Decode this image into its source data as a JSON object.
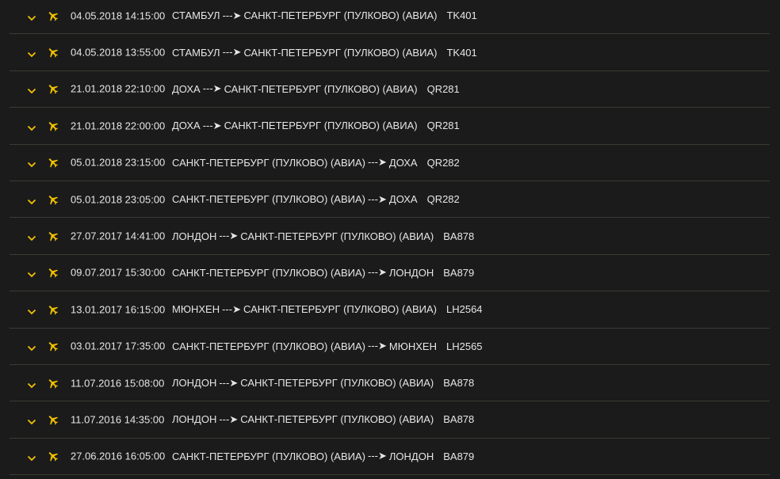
{
  "colors": {
    "background": "#1b1b1b",
    "accent": "#f2c200",
    "text": "#e6e6e6",
    "divider": "#3a3a34"
  },
  "icons": {
    "expand": "chevron-down-icon",
    "flight": "airplane-icon"
  },
  "flights": [
    {
      "datetime": "04.05.2018 14:15:00",
      "from": "СТАМБУЛ",
      "arrow": "---➤",
      "to": "САНКТ-ПЕТЕРБУРГ (ПУЛКОВО) (АВИА)",
      "flight": "TK401"
    },
    {
      "datetime": "04.05.2018 13:55:00",
      "from": "СТАМБУЛ",
      "arrow": "---➤",
      "to": "САНКТ-ПЕТЕРБУРГ (ПУЛКОВО) (АВИА)",
      "flight": "TK401"
    },
    {
      "datetime": "21.01.2018 22:10:00",
      "from": "ДОХА",
      "arrow": "---➤",
      "to": "САНКТ-ПЕТЕРБУРГ (ПУЛКОВО) (АВИА)",
      "flight": "QR281"
    },
    {
      "datetime": "21.01.2018 22:00:00",
      "from": "ДОХА",
      "arrow": "---➤",
      "to": "САНКТ-ПЕТЕРБУРГ (ПУЛКОВО) (АВИА)",
      "flight": "QR281"
    },
    {
      "datetime": "05.01.2018 23:15:00",
      "from": "САНКТ-ПЕТЕРБУРГ (ПУЛКОВО) (АВИА)",
      "arrow": "---➤",
      "to": "ДОХА",
      "flight": "QR282"
    },
    {
      "datetime": "05.01.2018 23:05:00",
      "from": "САНКТ-ПЕТЕРБУРГ (ПУЛКОВО) (АВИА)",
      "arrow": "---➤",
      "to": "ДОХА",
      "flight": "QR282"
    },
    {
      "datetime": "27.07.2017 14:41:00",
      "from": "ЛОНДОН",
      "arrow": "---➤",
      "to": "САНКТ-ПЕТЕРБУРГ (ПУЛКОВО) (АВИА)",
      "flight": "BA878"
    },
    {
      "datetime": "09.07.2017 15:30:00",
      "from": "САНКТ-ПЕТЕРБУРГ (ПУЛКОВО) (АВИА)",
      "arrow": "---➤",
      "to": "ЛОНДОН",
      "flight": "BA879"
    },
    {
      "datetime": "13.01.2017 16:15:00",
      "from": "МЮНХЕН",
      "arrow": "---➤",
      "to": "САНКТ-ПЕТЕРБУРГ (ПУЛКОВО) (АВИА)",
      "flight": "LH2564"
    },
    {
      "datetime": "03.01.2017 17:35:00",
      "from": "САНКТ-ПЕТЕРБУРГ (ПУЛКОВО) (АВИА)",
      "arrow": "---➤",
      "to": "МЮНХЕН",
      "flight": "LH2565"
    },
    {
      "datetime": "11.07.2016 15:08:00",
      "from": "ЛОНДОН",
      "arrow": "---➤",
      "to": "САНКТ-ПЕТЕРБУРГ (ПУЛКОВО) (АВИА)",
      "flight": "BA878"
    },
    {
      "datetime": "11.07.2016 14:35:00",
      "from": "ЛОНДОН",
      "arrow": "---➤",
      "to": "САНКТ-ПЕТЕРБУРГ (ПУЛКОВО) (АВИА)",
      "flight": "BA878"
    },
    {
      "datetime": "27.06.2016 16:05:00",
      "from": "САНКТ-ПЕТЕРБУРГ (ПУЛКОВО) (АВИА)",
      "arrow": "---➤",
      "to": "ЛОНДОН",
      "flight": "BA879"
    }
  ]
}
